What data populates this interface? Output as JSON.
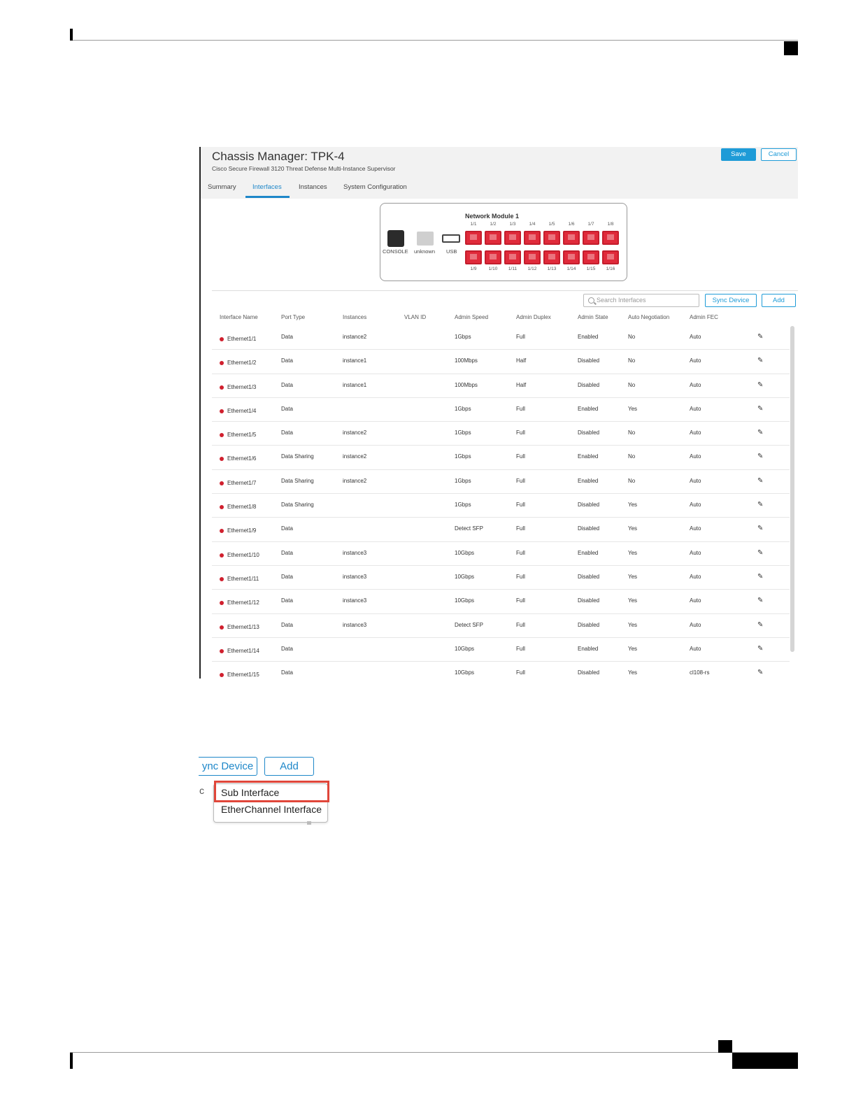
{
  "chassis": {
    "title": "Chassis Manager: TPK-4",
    "subtitle": "Cisco Secure Firewall 3120 Threat Defense Multi-Instance Supervisor",
    "save_label": "Save",
    "cancel_label": "Cancel",
    "tabs": [
      "Summary",
      "Interfaces",
      "Instances",
      "System Configuration"
    ],
    "active_tab": "Interfaces"
  },
  "network_module": {
    "title": "Network Module 1",
    "console_label": "CONSOLE",
    "unknown_label": "unknown",
    "usb_label": "USB",
    "top_ports": [
      "1/1",
      "1/2",
      "1/3",
      "1/4",
      "1/5",
      "1/6",
      "1/7",
      "1/8"
    ],
    "bottom_ports": [
      "1/9",
      "1/10",
      "1/11",
      "1/12",
      "1/13",
      "1/14",
      "1/15",
      "1/16"
    ],
    "port_color": "#e02a3a"
  },
  "toolbar": {
    "search_placeholder": "Search Interfaces",
    "sync_label": "Sync Device",
    "add_label": "Add"
  },
  "table": {
    "headers": [
      "Interface Name",
      "Port Type",
      "Instances",
      "VLAN ID",
      "Admin Speed",
      "Admin Duplex",
      "Admin State",
      "Auto Negotiation",
      "Admin FEC"
    ],
    "rows": [
      [
        "Ethernet1/1",
        "Data",
        "instance2",
        "",
        "1Gbps",
        "Full",
        "Enabled",
        "No",
        "Auto"
      ],
      [
        "Ethernet1/2",
        "Data",
        "instance1",
        "",
        "100Mbps",
        "Half",
        "Disabled",
        "No",
        "Auto"
      ],
      [
        "Ethernet1/3",
        "Data",
        "instance1",
        "",
        "100Mbps",
        "Half",
        "Disabled",
        "No",
        "Auto"
      ],
      [
        "Ethernet1/4",
        "Data",
        "",
        "",
        "1Gbps",
        "Full",
        "Enabled",
        "Yes",
        "Auto"
      ],
      [
        "Ethernet1/5",
        "Data",
        "instance2",
        "",
        "1Gbps",
        "Full",
        "Disabled",
        "No",
        "Auto"
      ],
      [
        "Ethernet1/6",
        "Data Sharing",
        "instance2",
        "",
        "1Gbps",
        "Full",
        "Enabled",
        "No",
        "Auto"
      ],
      [
        "Ethernet1/7",
        "Data Sharing",
        "instance2",
        "",
        "1Gbps",
        "Full",
        "Enabled",
        "No",
        "Auto"
      ],
      [
        "Ethernet1/8",
        "Data Sharing",
        "",
        "",
        "1Gbps",
        "Full",
        "Disabled",
        "Yes",
        "Auto"
      ],
      [
        "Ethernet1/9",
        "Data",
        "",
        "",
        "Detect SFP",
        "Full",
        "Disabled",
        "Yes",
        "Auto"
      ],
      [
        "Ethernet1/10",
        "Data",
        "instance3",
        "",
        "10Gbps",
        "Full",
        "Enabled",
        "Yes",
        "Auto"
      ],
      [
        "Ethernet1/11",
        "Data",
        "instance3",
        "",
        "10Gbps",
        "Full",
        "Disabled",
        "Yes",
        "Auto"
      ],
      [
        "Ethernet1/12",
        "Data",
        "instance3",
        "",
        "10Gbps",
        "Full",
        "Disabled",
        "Yes",
        "Auto"
      ],
      [
        "Ethernet1/13",
        "Data",
        "instance3",
        "",
        "Detect SFP",
        "Full",
        "Disabled",
        "Yes",
        "Auto"
      ],
      [
        "Ethernet1/14",
        "Data",
        "",
        "",
        "10Gbps",
        "Full",
        "Enabled",
        "Yes",
        "Auto"
      ],
      [
        "Ethernet1/15",
        "Data",
        "",
        "",
        "10Gbps",
        "Full",
        "Disabled",
        "Yes",
        "cl108-rs"
      ]
    ],
    "status_dot_color": "#d0202e"
  },
  "zoom": {
    "sync_label_partial": "ync Device",
    "add_label": "Add",
    "partial_char": "c",
    "menu_items": [
      "Sub Interface",
      "EtherChannel Interface"
    ],
    "highlighted_item": "Sub Interface",
    "highlight_color": "#e0463a"
  }
}
